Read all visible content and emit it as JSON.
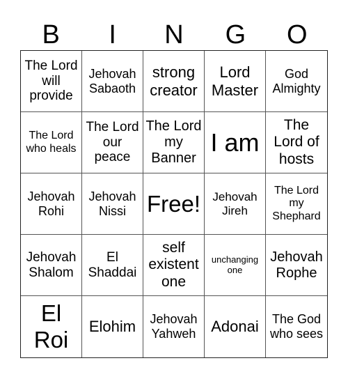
{
  "header": {
    "letters": [
      "B",
      "I",
      "N",
      "G",
      "O"
    ]
  },
  "cells": [
    {
      "text": "The Lord will provide",
      "size": "s19"
    },
    {
      "text": "Jehovah Sabaoth",
      "size": "s18"
    },
    {
      "text": "strong creator",
      "size": "s22"
    },
    {
      "text": "Lord Master",
      "size": "s22"
    },
    {
      "text": "God Almighty",
      "size": "s18"
    },
    {
      "text": "The Lord who heals",
      "size": "s16"
    },
    {
      "text": "The Lord our peace",
      "size": "s19"
    },
    {
      "text": "The Lord my Banner",
      "size": "s20"
    },
    {
      "text": "I am",
      "size": "s36"
    },
    {
      "text": "The Lord of hosts",
      "size": "s21"
    },
    {
      "text": "Jehovah Rohi",
      "size": "s18"
    },
    {
      "text": "Jehovah Nissi",
      "size": "s18"
    },
    {
      "text": "Free!",
      "size": "s32"
    },
    {
      "text": "Jehovah Jireh",
      "size": "s17"
    },
    {
      "text": "The Lord my Shephard",
      "size": "s16"
    },
    {
      "text": "Jehovah Shalom",
      "size": "s19"
    },
    {
      "text": "El Shaddai",
      "size": "s19"
    },
    {
      "text": "self existent one",
      "size": "s21"
    },
    {
      "text": "unchanging one",
      "size": "s13"
    },
    {
      "text": "Jehovah Rophe",
      "size": "s20"
    },
    {
      "text": "El Roi",
      "size": "s32"
    },
    {
      "text": "Elohim",
      "size": "s22"
    },
    {
      "text": "Jehovah Yahweh",
      "size": "s18"
    },
    {
      "text": "Adonai",
      "size": "s22"
    },
    {
      "text": "The God who sees",
      "size": "s18"
    }
  ]
}
